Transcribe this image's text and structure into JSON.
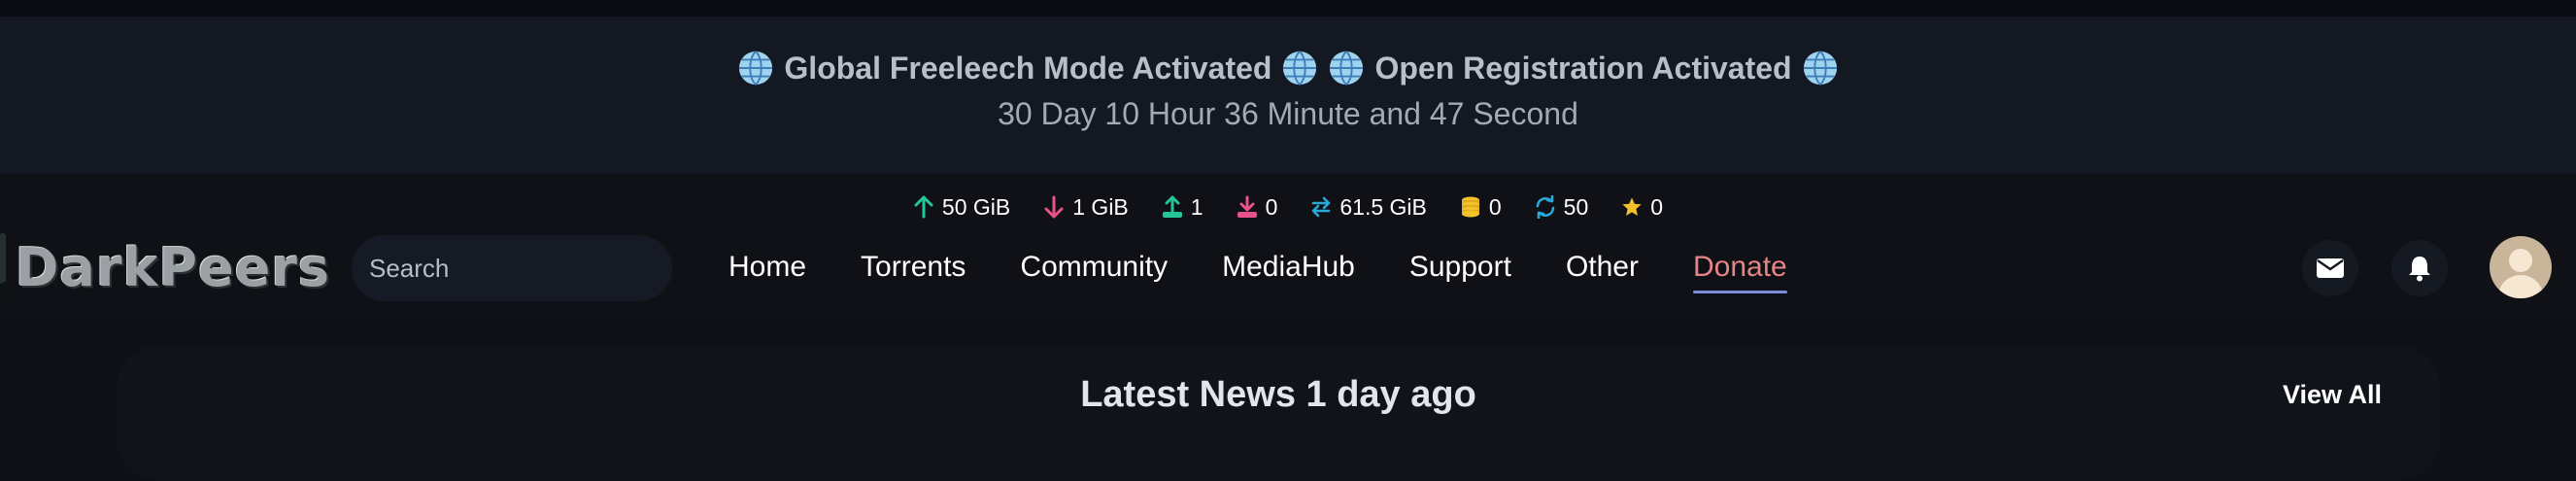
{
  "banner": {
    "freeleech": "Global Freeleech Mode Activated",
    "registration": "Open Registration Activated",
    "countdown": "30 Day 10 Hour 36 Minute and 47 Second"
  },
  "stats": {
    "upload": "50 GiB",
    "download": "1 GiB",
    "seeding": "1",
    "leeching": "0",
    "ratio_buffer": "61.5 GiB",
    "bonus": "0",
    "active": "50",
    "freeleech_tokens": "0"
  },
  "colors": {
    "up": "#25c59a",
    "down": "#e8528a",
    "buffer": "#29a9d8",
    "bonus": "#f4c22b",
    "donate": "#e68585"
  },
  "logo": {
    "text": "DarkPeers"
  },
  "search": {
    "placeholder": "Search"
  },
  "nav": {
    "home": "Home",
    "torrents": "Torrents",
    "community": "Community",
    "mediahub": "MediaHub",
    "support": "Support",
    "other": "Other",
    "donate": "Donate"
  },
  "icons": {
    "globe": "globe-icon",
    "mail": "envelope-icon",
    "bell": "bell-icon",
    "avatar": "avatar"
  },
  "news": {
    "title": "Latest News 1 day ago",
    "view_all": "View All"
  }
}
